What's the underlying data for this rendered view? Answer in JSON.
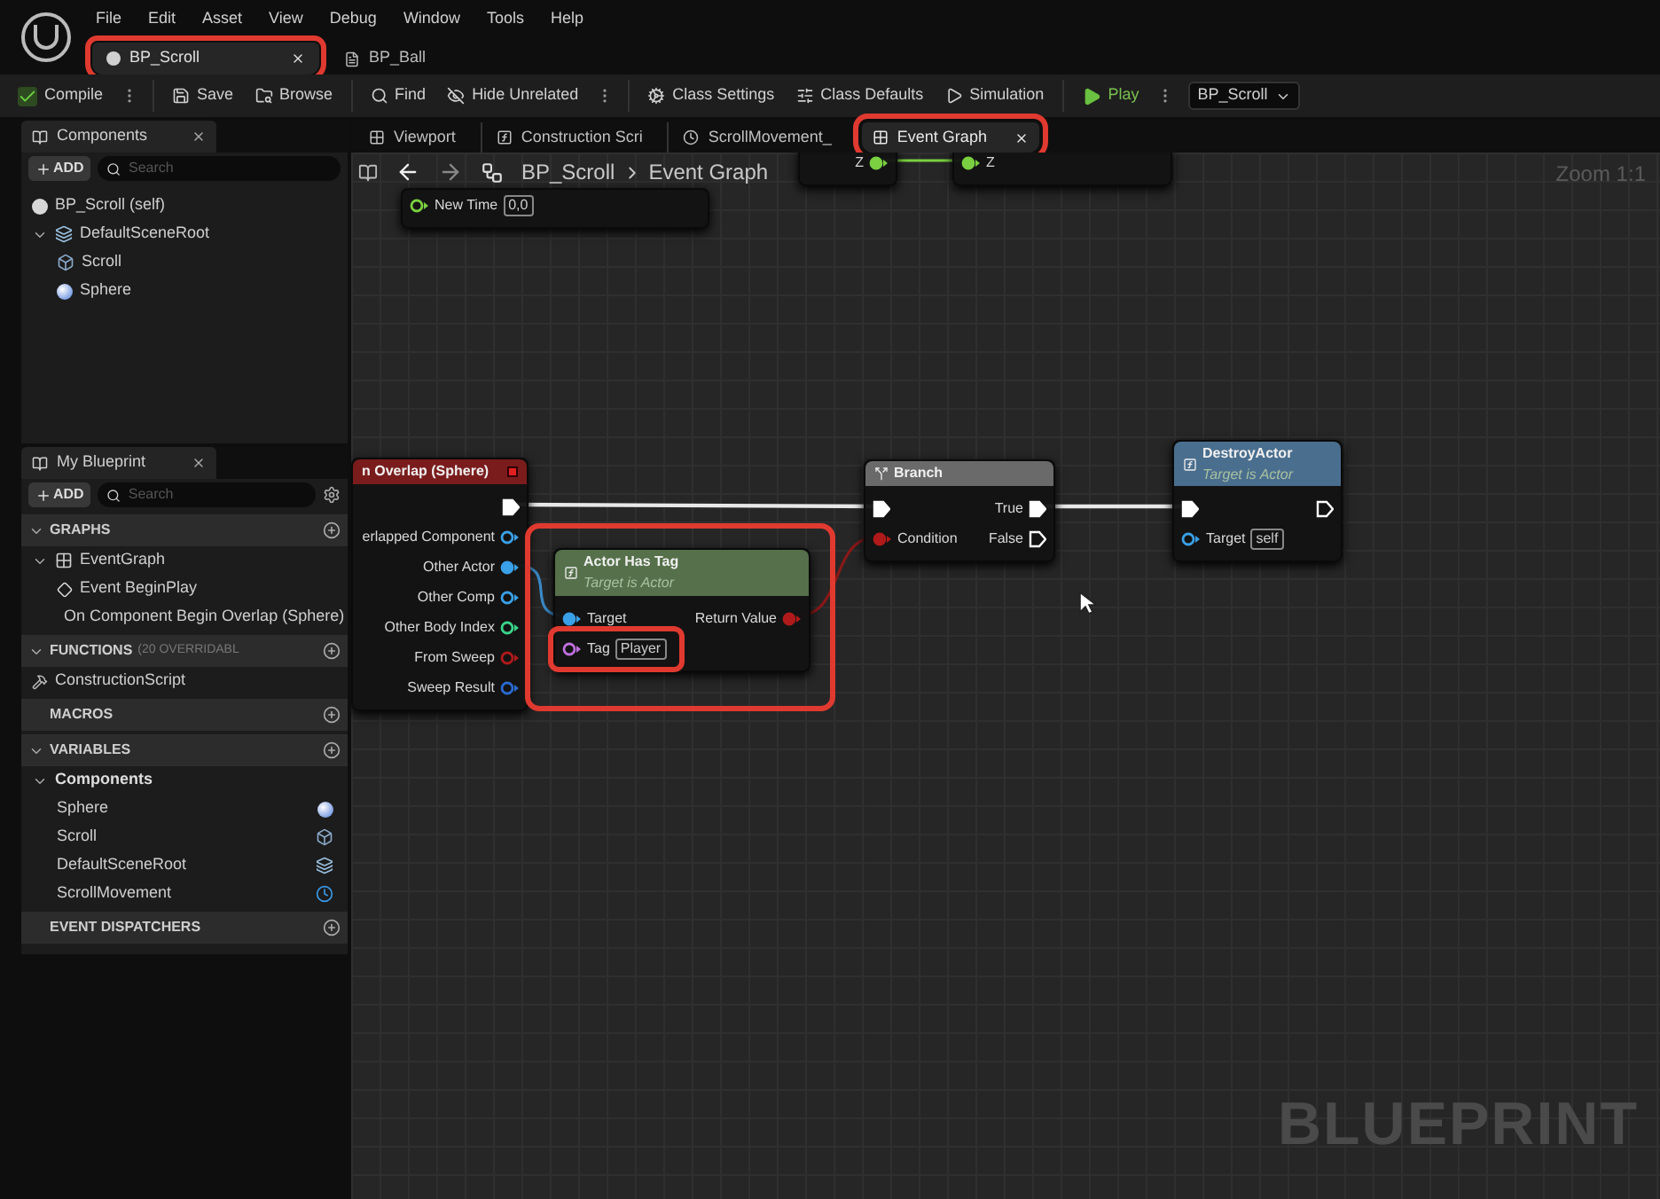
{
  "menu": [
    "File",
    "Edit",
    "Asset",
    "View",
    "Debug",
    "Window",
    "Tools",
    "Help"
  ],
  "document_tabs": [
    {
      "label": "BP_Scroll",
      "kind": "blueprint",
      "selected": true,
      "highlighted": true
    },
    {
      "label": "BP_Ball",
      "kind": "actor",
      "selected": false,
      "highlighted": false
    }
  ],
  "toolbar": [
    {
      "kind": "compile",
      "label": "Compile"
    },
    {
      "kind": "save",
      "label": "Save"
    },
    {
      "kind": "browse",
      "label": "Browse"
    },
    {
      "kind": "find",
      "label": "Find"
    },
    {
      "kind": "hide",
      "label": "Hide Unrelated"
    },
    {
      "kind": "settings",
      "label": "Class Settings"
    },
    {
      "kind": "defaults",
      "label": "Class Defaults"
    },
    {
      "kind": "simulation",
      "label": "Simulation"
    },
    {
      "kind": "play",
      "label": "Play"
    }
  ],
  "play_target": "BP_Scroll",
  "components": {
    "title": "Components",
    "add": "ADD",
    "search_placeholder": "Search",
    "tree": [
      {
        "label": "BP_Scroll (self)",
        "kind": "self"
      },
      {
        "label": "DefaultSceneRoot",
        "kind": "scene",
        "expanded": true,
        "children": [
          {
            "label": "Scroll",
            "kind": "mesh"
          },
          {
            "label": "Sphere",
            "kind": "sphere"
          }
        ]
      }
    ]
  },
  "my_blueprint": {
    "title": "My Blueprint",
    "add": "ADD",
    "search_placeholder": "Search",
    "sections": [
      {
        "title": "GRAPHS",
        "expanded": true,
        "items": [
          {
            "label": "EventGraph",
            "kind": "graph",
            "expanded": true,
            "children": [
              {
                "label": "Event BeginPlay",
                "kind": "event"
              },
              {
                "label": "On Component Begin Overlap (Sphere)",
                "kind": "event"
              }
            ]
          }
        ]
      },
      {
        "title": "FUNCTIONS",
        "note": "(20 OVERRIDABL",
        "expanded": true,
        "items": [
          {
            "label": "ConstructionScript",
            "kind": "function"
          }
        ]
      },
      {
        "title": "MACROS",
        "expanded": false
      },
      {
        "title": "VARIABLES",
        "expanded": true,
        "items": [
          {
            "label": "Components",
            "kind": "category",
            "expanded": true,
            "children": [
              {
                "label": "Sphere",
                "kind": "sphere"
              },
              {
                "label": "Scroll",
                "kind": "mesh"
              },
              {
                "label": "DefaultSceneRoot",
                "kind": "scene"
              },
              {
                "label": "ScrollMovement",
                "kind": "movement"
              }
            ]
          }
        ]
      },
      {
        "title": "EVENT DISPATCHERS",
        "expanded": false
      }
    ]
  },
  "graph": {
    "tabs": [
      {
        "label": "Viewport",
        "kind": "viewport",
        "selected": false,
        "highlighted": false
      },
      {
        "label": "Construction Scri",
        "kind": "function",
        "selected": false,
        "highlighted": false
      },
      {
        "label": "ScrollMovement_",
        "kind": "movement",
        "selected": false,
        "highlighted": false
      },
      {
        "label": "Event Graph",
        "kind": "graph",
        "selected": true,
        "highlighted": true
      }
    ],
    "breadcrumb": [
      "BP_Scroll",
      "Event Graph"
    ],
    "zoom": "Zoom 1:1",
    "watermark": "BLUEPRINT",
    "nodes": [
      {
        "kind": "partial",
        "highlighted": false,
        "inputs": [
          {
            "label": "New Time",
            "kind": "float",
            "connected": false,
            "value": "0,0"
          }
        ]
      },
      {
        "kind": "partial",
        "highlighted": false,
        "outputs": [
          {
            "label": "Z",
            "kind": "float",
            "connected": true
          }
        ]
      },
      {
        "kind": "partial",
        "highlighted": false,
        "inputs": [
          {
            "label": "Z",
            "kind": "float",
            "connected": true
          }
        ]
      },
      {
        "kind": "event",
        "title": "n Overlap (Sphere)",
        "color": "#7a1c1c",
        "highlighted": false,
        "outputs": [
          {
            "kind": "exec",
            "connected": true
          },
          {
            "label": "erlapped Component",
            "kind": "object",
            "connected": false
          },
          {
            "label": "Other Actor",
            "kind": "object",
            "connected": true
          },
          {
            "label": "Other Comp",
            "kind": "object",
            "connected": false
          },
          {
            "label": "Other Body Index",
            "kind": "int",
            "connected": false
          },
          {
            "label": "From Sweep",
            "kind": "bool",
            "connected": false
          },
          {
            "label": "Sweep Result",
            "kind": "struct",
            "connected": false
          }
        ]
      },
      {
        "kind": "function",
        "title": "Actor Has Tag",
        "subtitle": "Target is Actor",
        "color": "#55704a",
        "highlighted": true,
        "inputs": [
          {
            "label": "Target",
            "kind": "object",
            "connected": true
          },
          {
            "label": "Tag",
            "kind": "name",
            "connected": false,
            "value": "Player",
            "highlighted": true
          }
        ],
        "outputs": [
          {
            "label": "Return Value",
            "kind": "bool",
            "connected": true
          }
        ]
      },
      {
        "kind": "branch",
        "title": "Branch",
        "color": "#6a6a6a",
        "highlighted": false,
        "inputs": [
          {
            "kind": "exec",
            "connected": true
          },
          {
            "label": "Condition",
            "kind": "bool",
            "connected": true
          }
        ],
        "outputs": [
          {
            "label": "True",
            "kind": "exec",
            "connected": true
          },
          {
            "label": "False",
            "kind": "exec",
            "connected": false
          }
        ]
      },
      {
        "kind": "function",
        "title": "DestroyActor",
        "subtitle": "Target is Actor",
        "color": "#4a6e8e",
        "highlighted": false,
        "inputs": [
          {
            "kind": "exec",
            "connected": true
          },
          {
            "label": "Target",
            "kind": "object",
            "connected": false,
            "value": "self"
          }
        ],
        "outputs": [
          {
            "kind": "exec",
            "connected": false
          }
        ]
      }
    ]
  }
}
